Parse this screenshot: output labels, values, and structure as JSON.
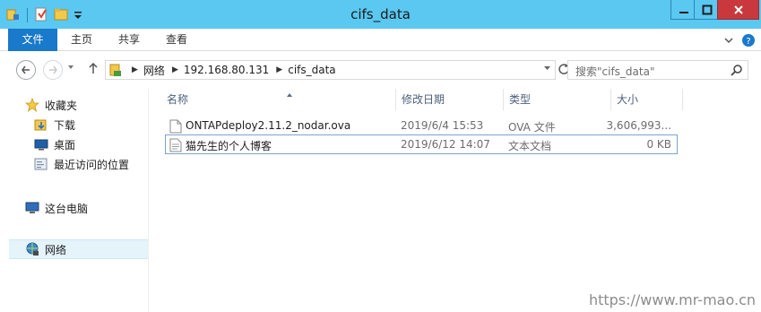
{
  "window": {
    "title": "cifs_data"
  },
  "ribbon": {
    "tabs": [
      {
        "label": "文件"
      },
      {
        "label": "主页"
      },
      {
        "label": "共享"
      },
      {
        "label": "查看"
      }
    ]
  },
  "address": {
    "crumbs": [
      "网络",
      "192.168.80.131",
      "cifs_data"
    ]
  },
  "search": {
    "placeholder": "搜索\"cifs_data\""
  },
  "navpane": {
    "items": [
      {
        "label": "收藏夹",
        "icon": "star-icon"
      },
      {
        "label": "下载",
        "icon": "download-folder-icon"
      },
      {
        "label": "桌面",
        "icon": "desktop-icon"
      },
      {
        "label": "最近访问的位置",
        "icon": "recent-places-icon"
      },
      {
        "label": "这台电脑",
        "icon": "computer-icon"
      },
      {
        "label": "网络",
        "icon": "network-icon"
      }
    ]
  },
  "filelist": {
    "columns": {
      "name": "名称",
      "date": "修改日期",
      "type": "类型",
      "size": "大小"
    },
    "rows": [
      {
        "name": "ONTAPdeploy2.11.2_nodar.ova",
        "date": "2019/6/4 15:53",
        "type": "OVA 文件",
        "size": "3,606,993..."
      },
      {
        "name": "猫先生的个人博客",
        "date": "2019/6/12 14:07",
        "type": "文本文档",
        "size": "0 KB"
      }
    ]
  },
  "watermark": "https://www.mr-mao.cn",
  "colors": {
    "titlebar": "#5ac8f1",
    "file_tab": "#1979ca",
    "close_button": "#c8383d",
    "selection_border": "#7da2ce"
  }
}
